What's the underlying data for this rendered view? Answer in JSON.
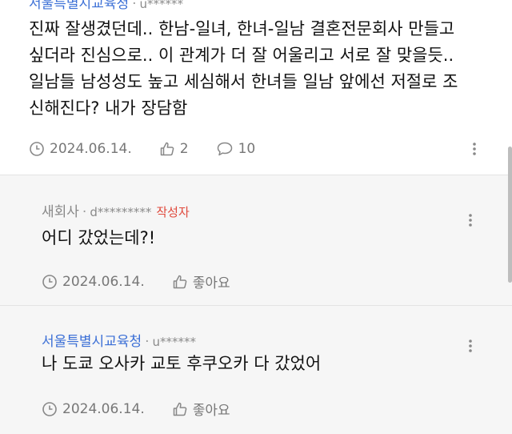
{
  "post": {
    "author": "서울특별시교육청",
    "user_id": "u******",
    "text_lines": [
      "진짜 잘생겼던데.. 한남-일녀, 한녀-일남 결혼전문회사 만들고",
      "싶더라 진심으로.. 이 관계가 더 잘 어울리고 서로 잘 맞을듯..",
      "일남들 남성성도 높고 세심해서 한녀들 일남 앞에선 저절로 조",
      "신해진다? 내가 장담함"
    ],
    "date": "2024.06.14.",
    "likes": "2",
    "replies_count": "10"
  },
  "replies": [
    {
      "author": "새회사",
      "user_id": "d*********",
      "badge": "작성자",
      "text": "어디 갔었는데?!",
      "date": "2024.06.14.",
      "like_label": "좋아요"
    },
    {
      "author": "서울특별시교육청",
      "user_id": "u******",
      "text": "나 도쿄 오사카 교토 후쿠오카 다 갔었어",
      "date": "2024.06.14.",
      "like_label": "좋아요"
    }
  ]
}
